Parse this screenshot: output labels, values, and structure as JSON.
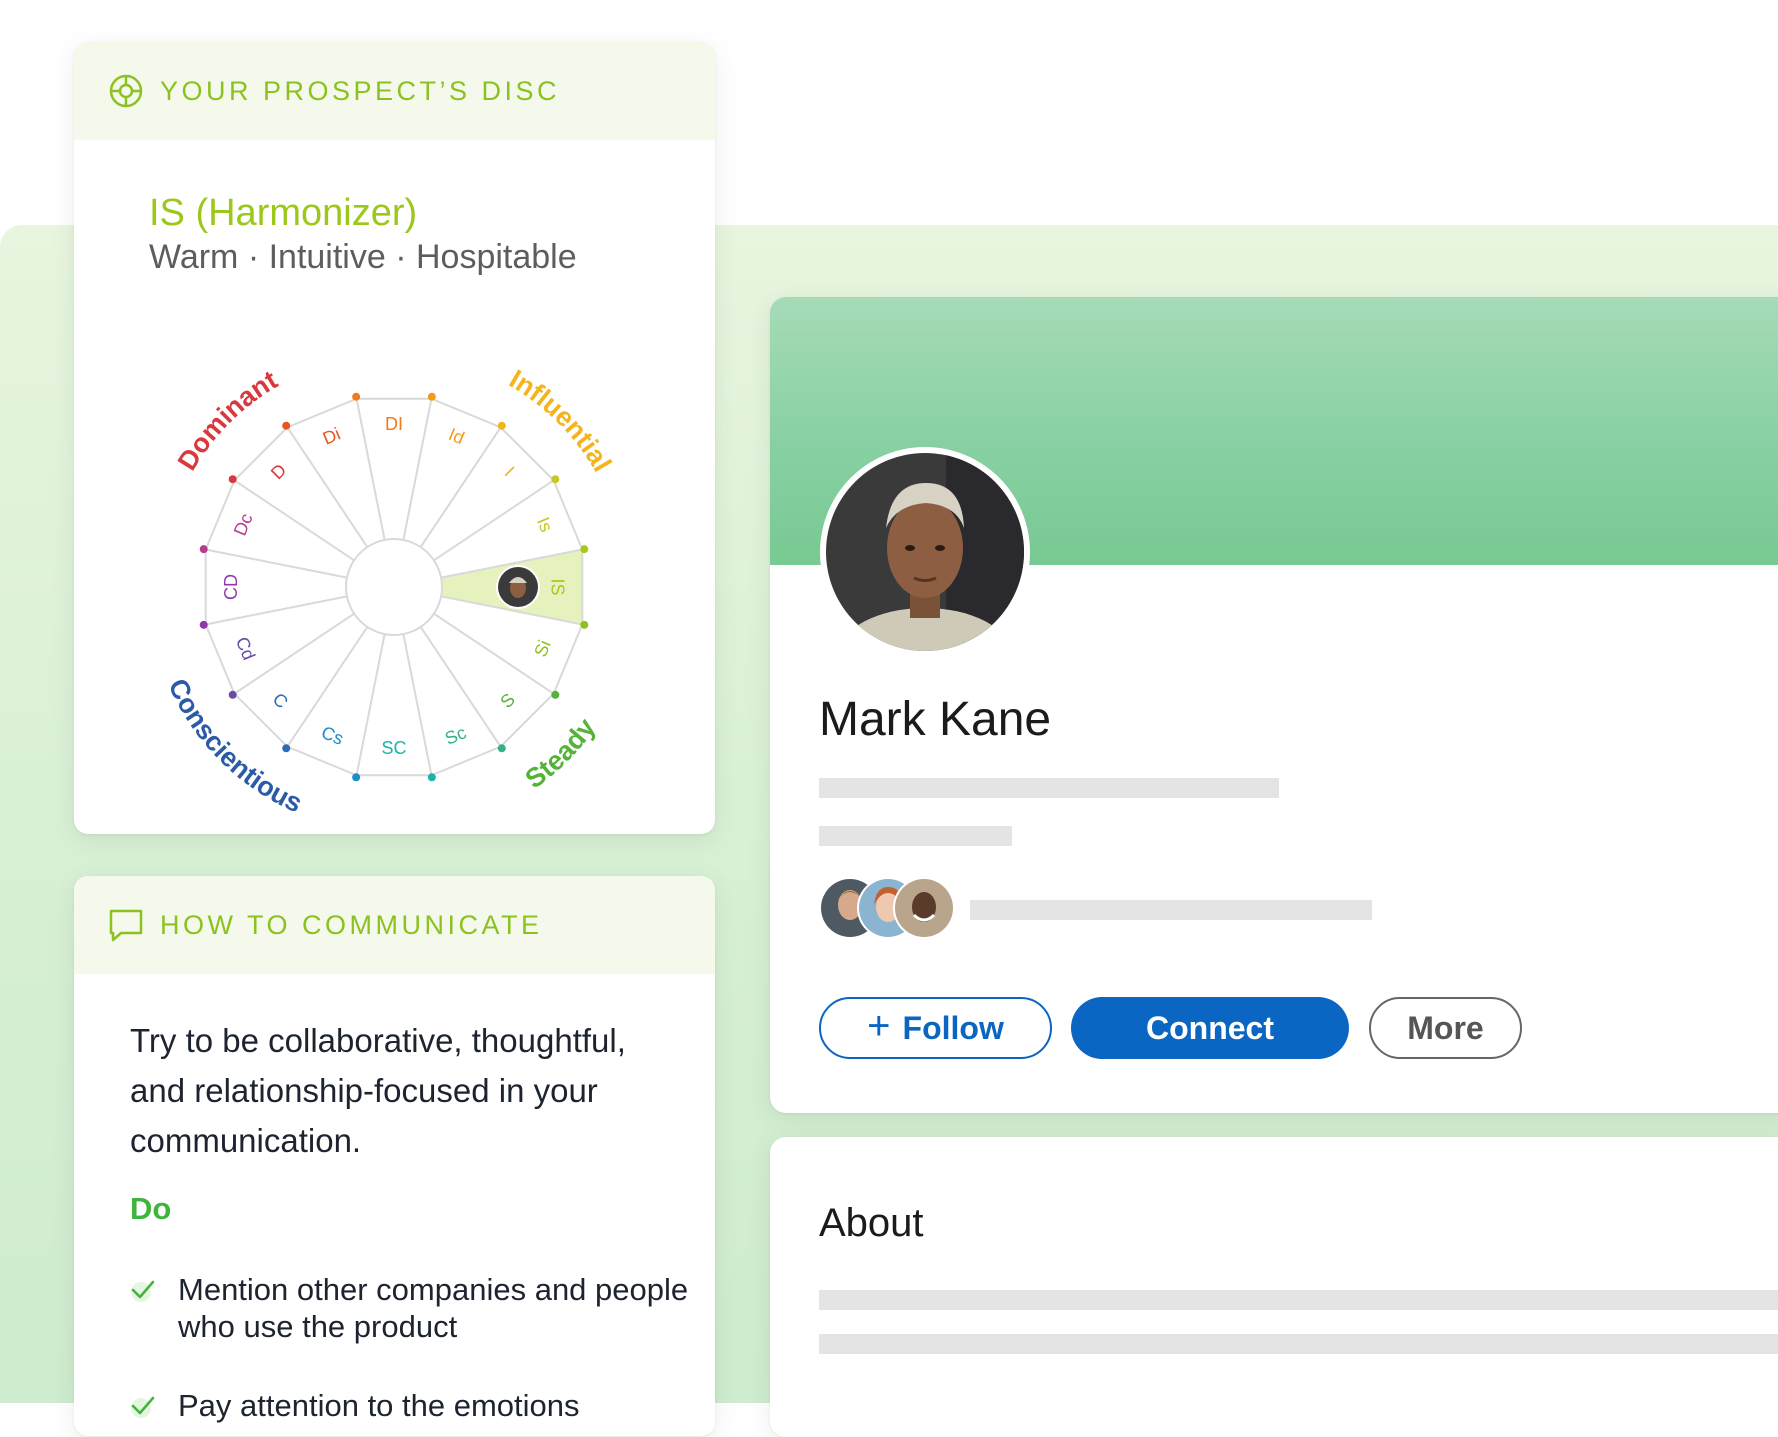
{
  "disc_card": {
    "header": "YOUR PROSPECT’S DISC",
    "type_title": "IS (Harmonizer)",
    "type_subtitle": "Warm · Intuitive · Hospitable",
    "highlighted_segment": "IS",
    "quadrants": [
      "Dominant",
      "Influential",
      "Steady",
      "Conscientious"
    ],
    "segments": [
      "DI",
      "Id",
      "I",
      "Is",
      "IS",
      "Si",
      "S",
      "Sc",
      "SC",
      "Cs",
      "C",
      "Cd",
      "CD",
      "Dc",
      "D",
      "Di"
    ],
    "colors": {
      "accent": "#8cc21f",
      "title": "#9bc81a",
      "highlight": "#e6f2bd"
    }
  },
  "communicate_card": {
    "header": "HOW TO COMMUNICATE",
    "body": "Try to be collaborative, thoughtful, and relationship-focused in your communication.",
    "do_label": "Do",
    "do_items": [
      "Mention other companies and people who use the product",
      "Pay attention to the emotions"
    ]
  },
  "profile": {
    "name": "Mark Kane",
    "buttons": {
      "follow": "Follow",
      "connect": "Connect",
      "more": "More"
    },
    "colors": {
      "primary": "#0a66c2",
      "banner": "#88d0a3"
    }
  },
  "about": {
    "title": "About"
  }
}
